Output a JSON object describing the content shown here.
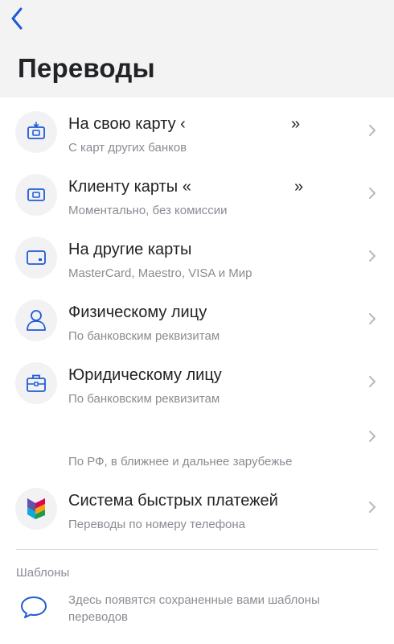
{
  "header": {
    "back_icon": "chevron-left-icon",
    "title": "Переводы"
  },
  "items": [
    {
      "title": "На свою карту ‹",
      "title_end": "»",
      "subtitle": "С карт других банков",
      "icon": "card-deposit-icon"
    },
    {
      "title": "Клиенту карты «",
      "title_end": "»",
      "subtitle": "Моментально, без комиссии",
      "icon": "bank-card-icon"
    },
    {
      "title": "На другие карты",
      "subtitle": "MasterCard, Maestro, VISA и Мир",
      "icon": "credit-card-icon"
    },
    {
      "title": "Физическому лицу",
      "subtitle": "По банковским реквизитам",
      "icon": "person-icon"
    },
    {
      "title": "Юридическому лицу",
      "subtitle": "По банковским реквизитам",
      "icon": "briefcase-icon"
    },
    {
      "title": "",
      "subtitle": "По РФ, в ближнее и дальнее зарубежье",
      "icon": ""
    },
    {
      "title": "Система быстрых платежей",
      "subtitle": "Переводы по номеру телефона",
      "icon": "sbp-logo-icon"
    }
  ],
  "templates": {
    "section_label": "Шаблоны",
    "empty_text": "Здесь появятся сохраненные вами шаблоны переводов",
    "icon": "chat-bubble-icon"
  },
  "colors": {
    "accent": "#1e5bd6",
    "text_primary": "#222326",
    "text_secondary": "#8a8c93",
    "header_bg": "#f3f3f3",
    "icon_bg": "#f2f2f4"
  }
}
